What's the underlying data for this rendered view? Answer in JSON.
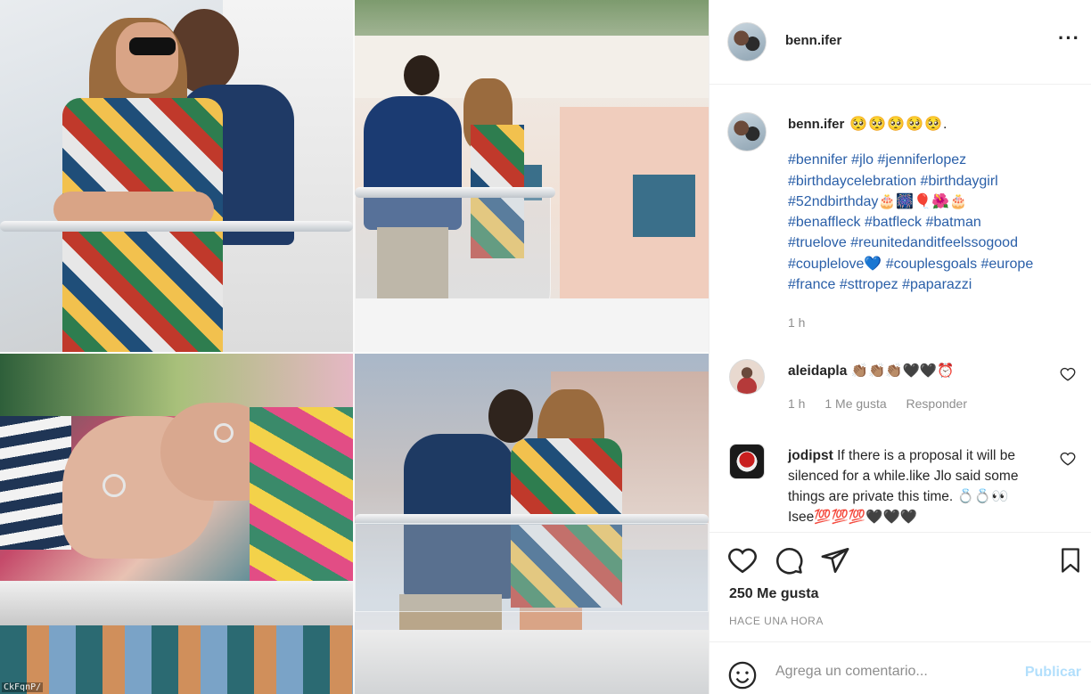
{
  "post": {
    "username": "benn.ifer",
    "more_icon": "more-horizontal-icon"
  },
  "caption": {
    "username": "benn.ifer",
    "emojis": "🥺🥺🥺🥺🥺.",
    "hashtag_lines": [
      "#bennifer #jlo #jenniferlopez",
      "#birthdaycelebration #birthdaygirl",
      "#52ndbirthday🎂🎆🎈🌺🎂",
      "#benaffleck #batfleck #batman",
      "#truelove #reunitedanditfeelssogood",
      "#couplelove💙 #couplesgoals #europe",
      "#france #sttropez #paparazzi"
    ],
    "time": "1 h"
  },
  "comments": [
    {
      "username": "aleidapla",
      "text": "👏🏽👏🏽👏🏽🖤🖤⏰",
      "time": "1 h",
      "likes": "1 Me gusta",
      "reply": "Responder"
    },
    {
      "username": "jodipst",
      "text": "If there is a proposal it will be silenced for a while.like Jlo said some things are private this time. 💍💍👀Isee💯💯💯🖤🖤🖤"
    }
  ],
  "actions": {
    "likes": "250 Me gusta",
    "ago": "HACE UNA HORA"
  },
  "add_comment": {
    "placeholder": "Agrega un comentario...",
    "publish": "Publicar"
  },
  "image": {
    "watermark": "CkFqnP/"
  }
}
